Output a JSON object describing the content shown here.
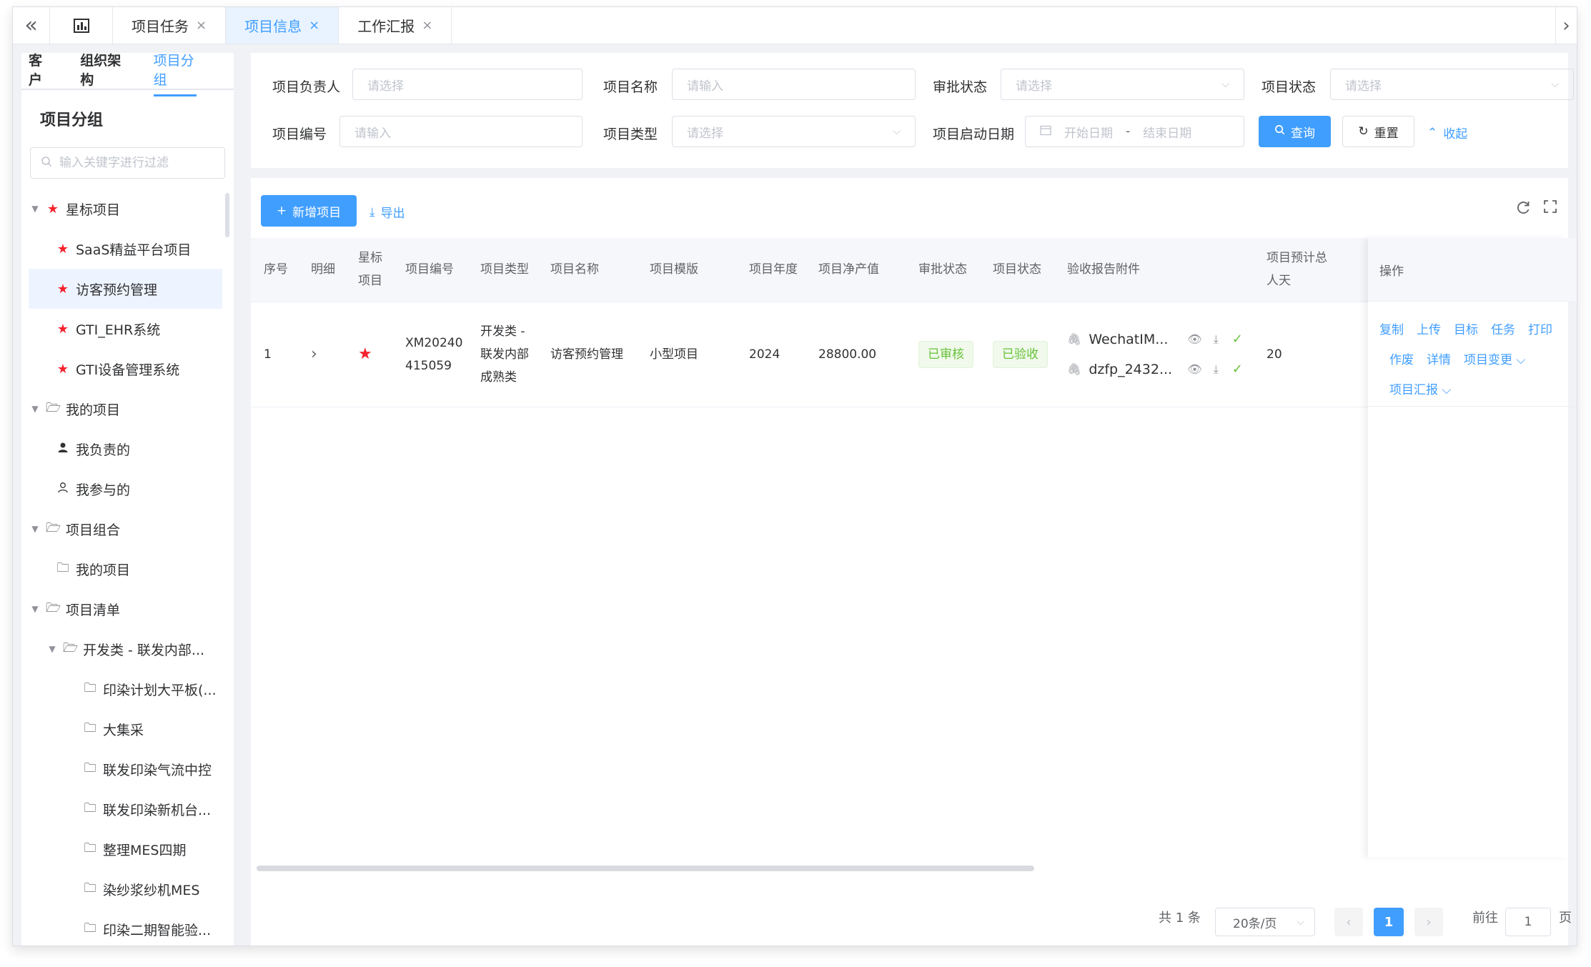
{
  "tabbar": {
    "collapse_icon": "double-chevron-left-icon",
    "dashboard_icon": "chart-icon",
    "tabs": [
      {
        "label": "项目任务"
      },
      {
        "label": "项目信息"
      },
      {
        "label": "工作汇报"
      }
    ],
    "close_glyph": "×"
  },
  "sidebar": {
    "tabs": [
      "客户",
      "组织架构",
      "项目分组"
    ],
    "title": "项目分组",
    "search_placeholder": "输入关键字进行过滤",
    "tree": [
      {
        "label": "星标项目"
      },
      {
        "label": "SaaS精益平台项目"
      },
      {
        "label": "访客预约管理"
      },
      {
        "label": "GTI_EHR系统"
      },
      {
        "label": "GTI设备管理系统"
      },
      {
        "label": "我的项目"
      },
      {
        "label": "我负责的"
      },
      {
        "label": "我参与的"
      },
      {
        "label": "项目组合"
      },
      {
        "label": "我的项目"
      },
      {
        "label": "项目清单"
      },
      {
        "label": "开发类 - 联发内部..."
      },
      {
        "label": "印染计划大平板(..."
      },
      {
        "label": "大集采"
      },
      {
        "label": "联发印染气流中控"
      },
      {
        "label": "联发印染新机台..."
      },
      {
        "label": "整理MES四期"
      },
      {
        "label": "染纱浆纱机MES"
      },
      {
        "label": "印染二期智能验..."
      }
    ]
  },
  "filter": {
    "owner_label": "项目负责人",
    "owner_placeholder": "请选择",
    "name_label": "项目名称",
    "name_placeholder": "请输入",
    "approval_label": "审批状态",
    "approval_placeholder": "请选择",
    "status_label": "项目状态",
    "status_placeholder": "请选择",
    "code_label": "项目编号",
    "code_placeholder": "请输入",
    "type_label": "项目类型",
    "type_placeholder": "请选择",
    "start_label": "项目启动日期",
    "start_placeholder": "开始日期",
    "date_sep": "-",
    "end_placeholder": "结束日期",
    "query_label": "查询",
    "reset_label": "重置",
    "collapse_label": "收起"
  },
  "toolbar": {
    "add_label": "新增项目",
    "export_label": "导出"
  },
  "table": {
    "headers": {
      "seq": "序号",
      "detail": "明细",
      "star_line1": "星标",
      "star_line2": "项目",
      "code": "项目编号",
      "type": "项目类型",
      "name": "项目名称",
      "template": "项目模版",
      "year": "项目年度",
      "value": "项目净产值",
      "approval": "审批状态",
      "status": "项目状态",
      "attachments": "验收报告附件",
      "days_line1": "项目预计总",
      "days_line2": "人天",
      "ops": "操作"
    },
    "row": {
      "seq": "1",
      "code_line1": "XM20240",
      "code_line2": "415059",
      "type_line1": "开发类 -",
      "type_line2": "联发内部",
      "type_line3": "成熟类",
      "name": "访客预约管理",
      "template": "小型项目",
      "year": "2024",
      "value": "28800.00",
      "approval": "已审核",
      "status": "已验收",
      "attachments": [
        "WechatIM...",
        "dzfp_2432..."
      ],
      "days": "20",
      "ops_row1": [
        "复制",
        "上传",
        "目标",
        "任务",
        "打印"
      ],
      "ops_row2": [
        "作废",
        "详情",
        "项目变更"
      ],
      "ops_row3": [
        "项目汇报"
      ]
    }
  },
  "pagination": {
    "total": "共 1 条",
    "page_size": "20条/页",
    "current": "1",
    "goto_label": "前往",
    "goto_value": "1",
    "page_suffix": "页"
  },
  "colors": {
    "accent": "#409eff",
    "success": "#67c23a",
    "star": "#f5222d"
  }
}
